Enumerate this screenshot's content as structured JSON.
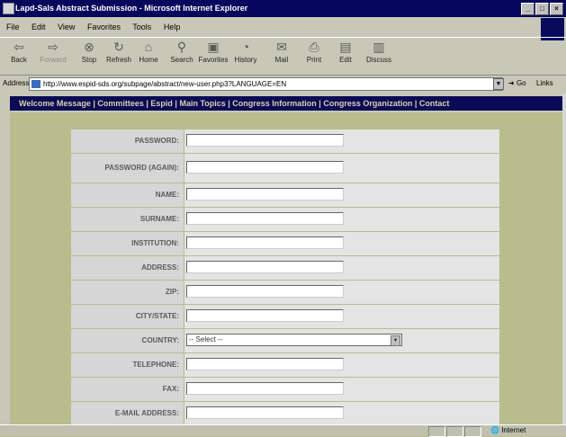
{
  "window": {
    "title": "Lapd-Sals Abstract Submission - Microsoft Internet Explorer",
    "controls": [
      "_",
      "□",
      "×"
    ]
  },
  "menu": [
    "File",
    "Edit",
    "View",
    "Favorites",
    "Tools",
    "Help"
  ],
  "toolbar": [
    {
      "label": "Back",
      "icon": "back-arrow-icon"
    },
    {
      "label": "Forward",
      "icon": "forward-arrow-icon",
      "disabled": true
    },
    {
      "label": "Stop",
      "icon": "stop-icon"
    },
    {
      "label": "Refresh",
      "icon": "refresh-icon"
    },
    {
      "label": "Home",
      "icon": "home-icon"
    },
    {
      "label": "Search",
      "icon": "search-icon"
    },
    {
      "label": "Favorites",
      "icon": "favorites-icon"
    },
    {
      "label": "History",
      "icon": "history-icon"
    },
    {
      "label": "Mail",
      "icon": "mail-icon"
    },
    {
      "label": "Print",
      "icon": "print-icon"
    },
    {
      "label": "Edit",
      "icon": "edit-icon"
    },
    {
      "label": "Discuss",
      "icon": "discuss-icon"
    }
  ],
  "address": {
    "label": "Address",
    "url": "http://www.espid-sds.org/subpage/abstract/new-user.php3?LANGUAGE=EN",
    "go": "Go",
    "links": "Links"
  },
  "nav": "Welcome Message | Committees | Espid | Main Topics | Congress Information | Congress Organization | Contact",
  "form": {
    "fields": [
      {
        "label": "PASSWORD:",
        "type": "input"
      },
      {
        "label": "PASSWORD (AGAIN):",
        "type": "input",
        "tall": true
      },
      {
        "label": "NAME:",
        "type": "input"
      },
      {
        "label": "SURNAME:",
        "type": "input"
      },
      {
        "label": "INSTITUTION:",
        "type": "input"
      },
      {
        "label": "ADDRESS:",
        "type": "input"
      },
      {
        "label": "ZIP:",
        "type": "input"
      },
      {
        "label": "CITY/STATE:",
        "type": "input"
      },
      {
        "label": "COUNTRY:",
        "type": "select",
        "value": "-- Select --"
      },
      {
        "label": "TELEPHONE:",
        "type": "input"
      },
      {
        "label": "FAX:",
        "type": "input"
      },
      {
        "label": "E-MAIL ADDRESS:",
        "type": "input"
      }
    ]
  },
  "status": {
    "zone": "Internet"
  },
  "colors": {
    "titlebar": "#06065c",
    "navbar": "#0b0b55",
    "page_bg": "#b7bd8c",
    "label_bg": "#d6d6d6"
  }
}
